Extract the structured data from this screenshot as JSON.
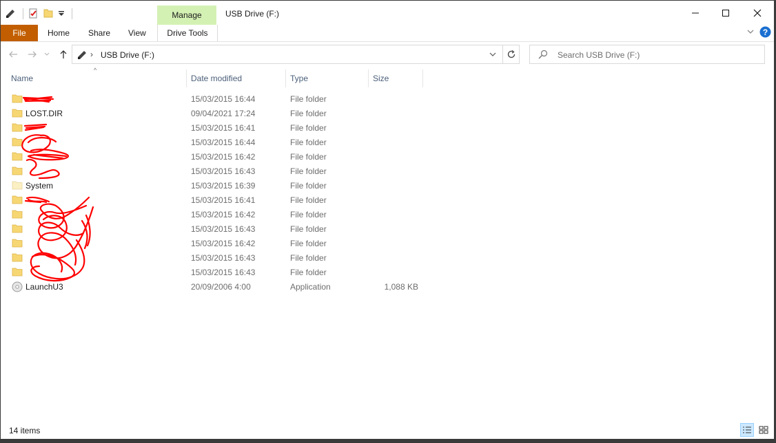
{
  "window": {
    "title": "USB Drive (F:)",
    "manage_label": "Manage"
  },
  "ribbon": {
    "file": "File",
    "home": "Home",
    "share": "Share",
    "view": "View",
    "drive_tools": "Drive Tools"
  },
  "address": {
    "path": "USB Drive (F:)"
  },
  "search": {
    "placeholder": "Search USB Drive (F:)"
  },
  "columns": {
    "name": "Name",
    "date": "Date modified",
    "type": "Type",
    "size": "Size"
  },
  "files": [
    {
      "name": "",
      "date": "15/03/2015 16:44",
      "type": "File folder",
      "size": "",
      "icon": "folder-icon"
    },
    {
      "name": "LOST.DIR",
      "date": "09/04/2021 17:24",
      "type": "File folder",
      "size": "",
      "icon": "folder-icon"
    },
    {
      "name": "",
      "date": "15/03/2015 16:41",
      "type": "File folder",
      "size": "",
      "icon": "folder-icon"
    },
    {
      "name": "",
      "date": "15/03/2015 16:44",
      "type": "File folder",
      "size": "",
      "icon": "folder-icon"
    },
    {
      "name": "",
      "date": "15/03/2015 16:42",
      "type": "File folder",
      "size": "",
      "icon": "folder-icon"
    },
    {
      "name": "",
      "date": "15/03/2015 16:43",
      "type": "File folder",
      "size": "",
      "icon": "folder-icon"
    },
    {
      "name": "System",
      "date": "15/03/2015 16:39",
      "type": "File folder",
      "size": "",
      "icon": "system-folder-icon"
    },
    {
      "name": "",
      "date": "15/03/2015 16:41",
      "type": "File folder",
      "size": "",
      "icon": "folder-icon"
    },
    {
      "name": "",
      "date": "15/03/2015 16:42",
      "type": "File folder",
      "size": "",
      "icon": "folder-icon"
    },
    {
      "name": "",
      "date": "15/03/2015 16:43",
      "type": "File folder",
      "size": "",
      "icon": "folder-icon"
    },
    {
      "name": "",
      "date": "15/03/2015 16:42",
      "type": "File folder",
      "size": "",
      "icon": "folder-icon"
    },
    {
      "name": "",
      "date": "15/03/2015 16:43",
      "type": "File folder",
      "size": "",
      "icon": "folder-icon"
    },
    {
      "name": "",
      "date": "15/03/2015 16:43",
      "type": "File folder",
      "size": "",
      "icon": "folder-icon"
    },
    {
      "name": "LaunchU3",
      "date": "20/09/2006 4:00",
      "type": "Application",
      "size": "1,088 KB",
      "icon": "cd-app-icon"
    }
  ],
  "status": {
    "item_count": "14 items"
  },
  "colors": {
    "file_tab": "#c25e00",
    "manage_tab": "#d4f1b4",
    "folder": "#f7d774",
    "header_text": "#4c607a",
    "scribble": "#ff0000"
  }
}
